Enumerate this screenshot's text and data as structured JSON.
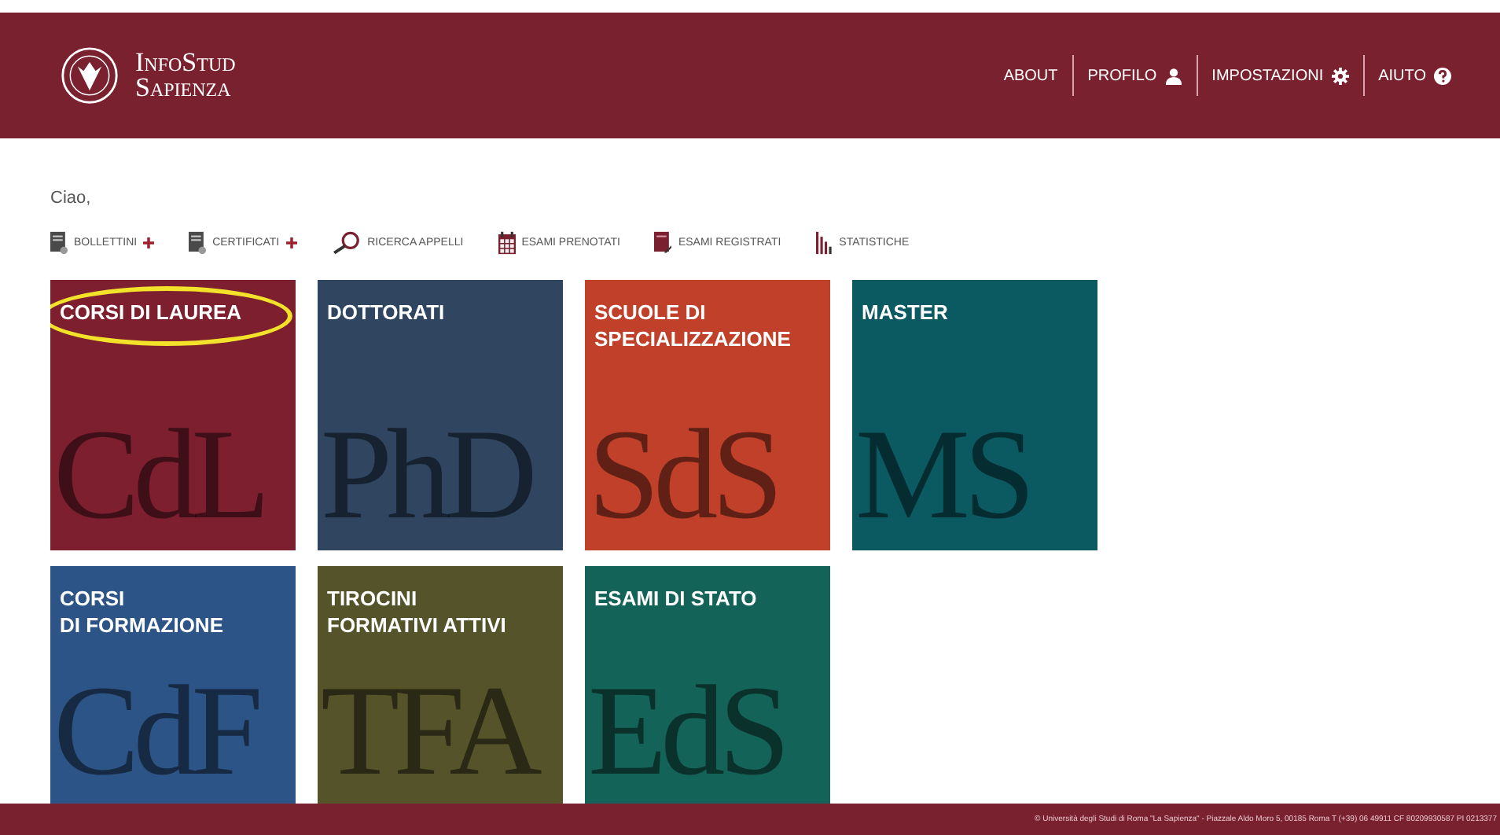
{
  "header": {
    "brand": [
      "InfoStud",
      "Sapienza"
    ],
    "nav": [
      {
        "label": "ABOUT",
        "kind": "plain"
      },
      {
        "label": "PROFILO",
        "kind": "profile"
      },
      {
        "label": "IMPOSTAZIONI",
        "kind": "settings"
      },
      {
        "label": "AIUTO",
        "kind": "help"
      }
    ]
  },
  "greeting": "Ciao,",
  "toolbar": [
    {
      "label": "BOLLETTINI",
      "kind": "document",
      "plus": true
    },
    {
      "label": "CERTIFICATI",
      "kind": "document",
      "plus": true
    },
    {
      "label": "RICERCA APPELLI",
      "kind": "search",
      "plus": false
    },
    {
      "label": "ESAMI PRENOTATI",
      "kind": "booking",
      "plus": false
    },
    {
      "label": "ESAMI REGISTRATI",
      "kind": "record",
      "plus": false
    },
    {
      "label": "STATISTICHE",
      "kind": "stats",
      "plus": false
    }
  ],
  "tiles": [
    [
      {
        "title": "CORSI DI LAUREA",
        "monogram": "CdL",
        "color": "#7d1f2f",
        "highlighted": true
      },
      {
        "title": "DOTTORATI",
        "monogram": "PhD",
        "color": "#2f4560",
        "highlighted": false
      },
      {
        "title": "SCUOLE DI SPECIALIZZAZIONE",
        "monogram": "SdS",
        "color": "#c0402a",
        "highlighted": false
      },
      {
        "title": "MASTER",
        "monogram": "MS",
        "color": "#0b5a62",
        "highlighted": false
      }
    ],
    [
      {
        "title": "CORSI\nDI FORMAZIONE",
        "monogram": "CdF",
        "color": "#2d5486",
        "highlighted": false
      },
      {
        "title": "TIROCINI\nFORMATIVI ATTIVI",
        "monogram": "TFA",
        "color": "#54532a",
        "highlighted": false
      },
      {
        "title": "ESAMI DI STATO",
        "monogram": "EdS",
        "color": "#146358",
        "highlighted": false
      }
    ]
  ],
  "footer": "© Università degli Studi di Roma \"La Sapienza\" - Piazzale Aldo Moro 5, 00185 Roma T (+39) 06 49911 CF 80209930587 PI 0213377"
}
